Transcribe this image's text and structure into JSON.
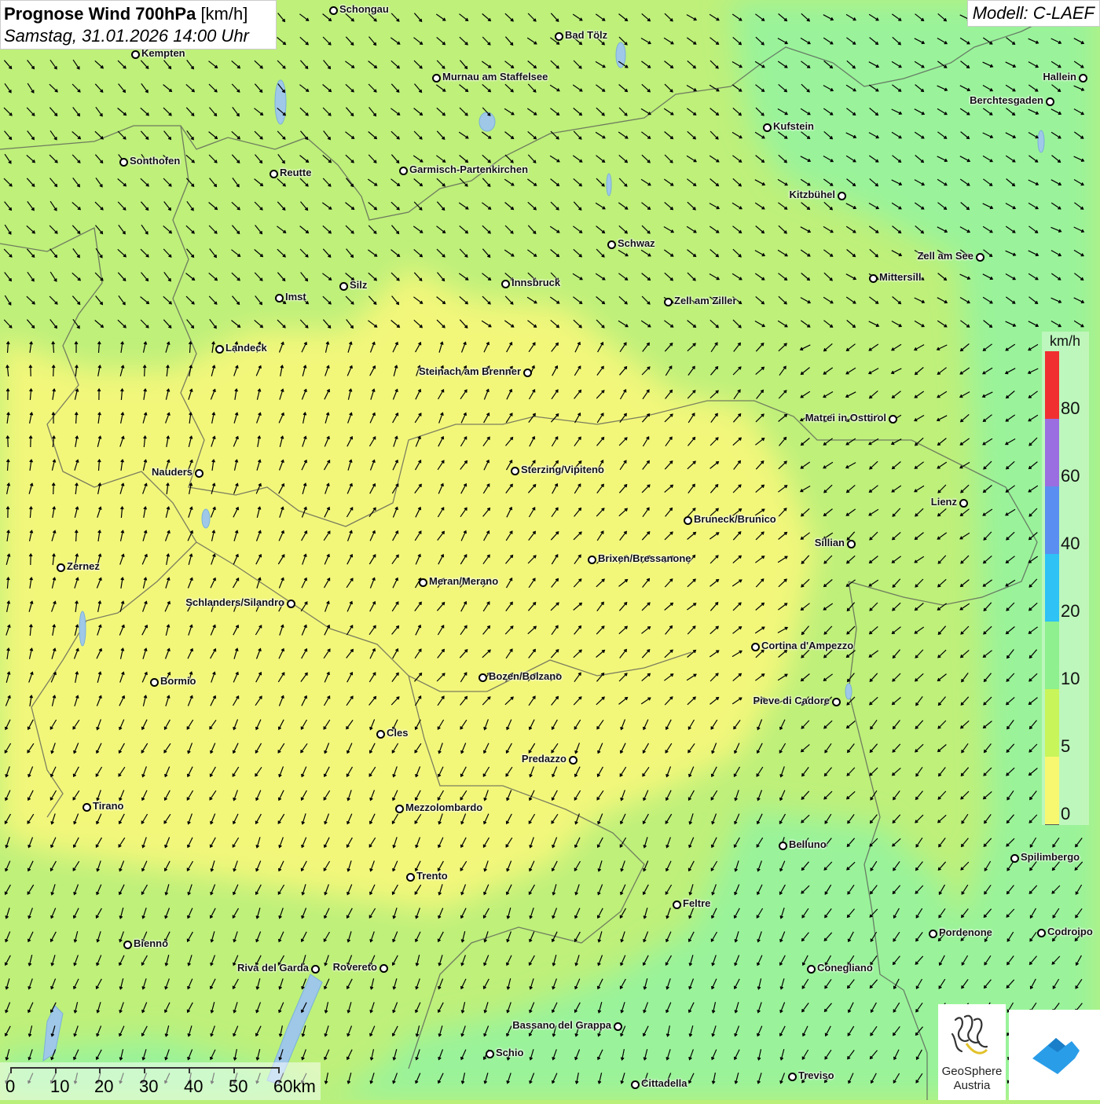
{
  "title": {
    "main_bold": "Prognose Wind 700hPa",
    "unit": "[km/h]",
    "date": "Samstag, 31.01.2026 14:00 Uhr"
  },
  "model": "Modell: C-LAEF",
  "legend": {
    "unit": "km/h",
    "labels": [
      "80",
      "60",
      "40",
      "20",
      "10",
      "5",
      "0"
    ],
    "colors": [
      "#f03030",
      "#9a6ee0",
      "#5a8ef0",
      "#2ec2f5",
      "#8ef08e",
      "#c8f55a",
      "#f8f870"
    ]
  },
  "scale": {
    "labels": [
      "0",
      "10",
      "20",
      "30",
      "40",
      "50",
      "60km"
    ]
  },
  "logo": {
    "line1": "GeoSphere",
    "line2": "Austria"
  },
  "cities": [
    {
      "name": "Schongau"
    },
    {
      "name": "Bad Tölz"
    },
    {
      "name": "Kempten"
    },
    {
      "name": "Murnau am Staffelsee"
    },
    {
      "name": "Hallein"
    },
    {
      "name": "Berchtesgaden"
    },
    {
      "name": "Kufstein"
    },
    {
      "name": "Sonthofen"
    },
    {
      "name": "Reutte"
    },
    {
      "name": "Garmisch-Partenkirchen"
    },
    {
      "name": "Kitzbühel"
    },
    {
      "name": "Schwaz"
    },
    {
      "name": "Zell am See"
    },
    {
      "name": "Mittersill"
    },
    {
      "name": "Innsbruck"
    },
    {
      "name": "Silz"
    },
    {
      "name": "Imst"
    },
    {
      "name": "Zell am Ziller"
    },
    {
      "name": "Landeck"
    },
    {
      "name": "Steinach am Brenner"
    },
    {
      "name": "Matrei in Osttirol"
    },
    {
      "name": "Nauders"
    },
    {
      "name": "Sterzing/Vipiteno"
    },
    {
      "name": "Lienz"
    },
    {
      "name": "Bruneck/Brunico"
    },
    {
      "name": "Sillian"
    },
    {
      "name": "Brixen/Bressanone"
    },
    {
      "name": "Zernez"
    },
    {
      "name": "Meran/Merano"
    },
    {
      "name": "Schlanders/Silandro"
    },
    {
      "name": "Cortina d'Ampezzo"
    },
    {
      "name": "Bozen/Bolzano"
    },
    {
      "name": "Bormio"
    },
    {
      "name": "Pieve di Cadore"
    },
    {
      "name": "Cles"
    },
    {
      "name": "Predazzo"
    },
    {
      "name": "Tirano"
    },
    {
      "name": "Mezzolombardo"
    },
    {
      "name": "Belluno"
    },
    {
      "name": "Spilimbergo"
    },
    {
      "name": "Trento"
    },
    {
      "name": "Feltre"
    },
    {
      "name": "Bienno"
    },
    {
      "name": "Pordenone"
    },
    {
      "name": "Codroipo"
    },
    {
      "name": "Riva del Garda"
    },
    {
      "name": "Rovereto"
    },
    {
      "name": "Conegliano"
    },
    {
      "name": "Bassano del Grappa"
    },
    {
      "name": "Schio"
    },
    {
      "name": "Treviso"
    },
    {
      "name": "Cittadella"
    }
  ]
}
